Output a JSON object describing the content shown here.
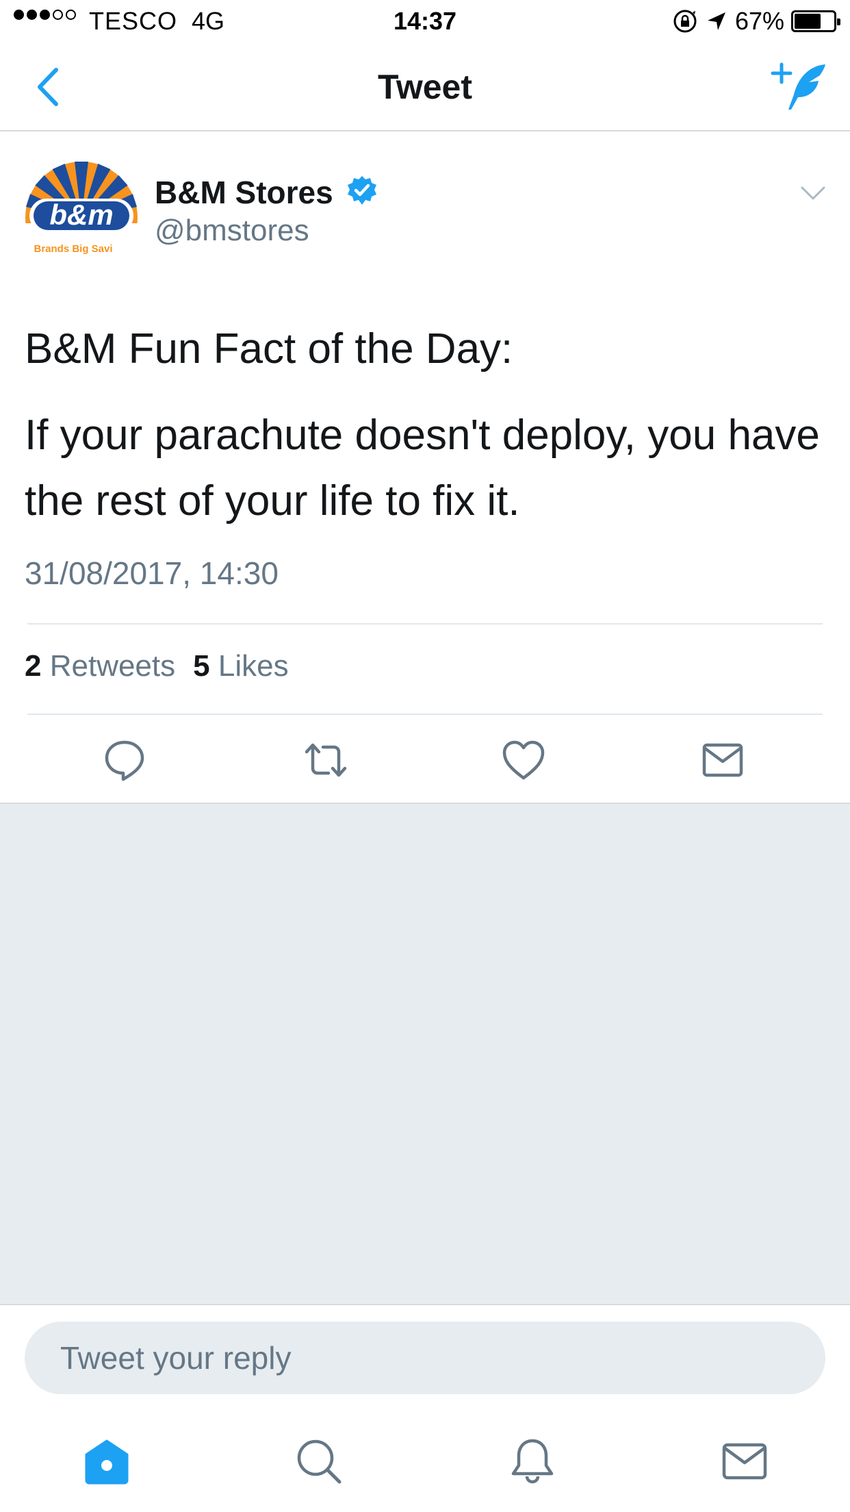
{
  "status_bar": {
    "carrier": "TESCO",
    "network": "4G",
    "time": "14:37",
    "battery_percent": "67%",
    "battery_level": 0.67,
    "signal_bars_filled": 3,
    "signal_bars_total": 5
  },
  "nav": {
    "title": "Tweet",
    "back_icon": "chevron-left-icon",
    "compose_icon": "compose-tweet-icon"
  },
  "tweet": {
    "author_name": "B&M Stores",
    "author_handle": "@bmstores",
    "verified": true,
    "avatar_logo_text": "b&m",
    "avatar_tagline": "Brands Big Savi",
    "text_line1": "B&M Fun Fact of the Day:",
    "text_line2": "If your parachute doesn't deploy, you have the rest of your life to fix it.",
    "timestamp": "31/08/2017, 14:30"
  },
  "stats": {
    "retweets_count": "2",
    "retweets_label": "Retweets",
    "likes_count": "5",
    "likes_label": "Likes"
  },
  "reply": {
    "placeholder": "Tweet your reply"
  },
  "colors": {
    "accent": "#1da1f2",
    "secondary_text": "#657786",
    "divider": "#e1e8ed",
    "background_gray": "#e6ecf0"
  },
  "tab_bar": {
    "tabs": [
      "home-icon",
      "search-icon",
      "notifications-icon",
      "messages-icon"
    ],
    "active": "home-icon"
  }
}
